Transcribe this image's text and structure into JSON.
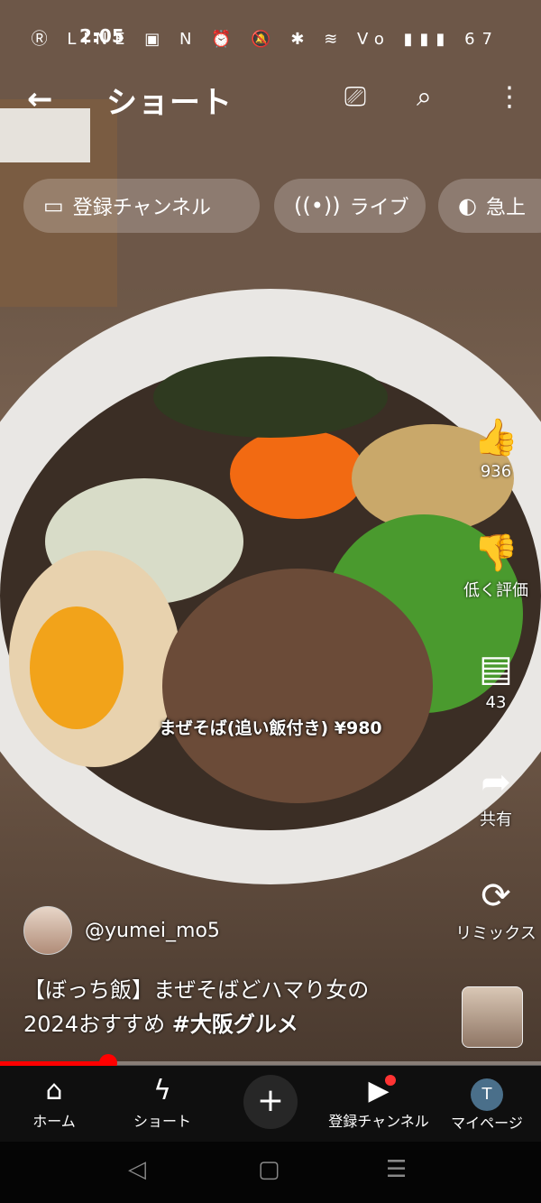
{
  "status_bar": {
    "time": "2:05",
    "icons_text": "Ⓡ LINE ▣      N ⏰ 🔕 ✱ ≋ Vo ▮▮▮ 67",
    "battery": "67"
  },
  "header": {
    "back_icon": "←",
    "title": "ショート",
    "cast_icon": "⎚",
    "search_icon": "⌕",
    "more_icon": "⋮"
  },
  "chips": [
    {
      "icon": "▭",
      "label": "登録チャンネル"
    },
    {
      "icon": "((•))",
      "label": "ライブ"
    },
    {
      "icon": "◐",
      "label": "急上"
    }
  ],
  "actions": {
    "like": {
      "icon": "👍",
      "label": "936"
    },
    "dislike": {
      "icon": "👎",
      "label": "低く評価"
    },
    "comment": {
      "icon": "▤",
      "label": "43"
    },
    "share": {
      "icon": "➦",
      "label": "共有"
    },
    "remix": {
      "icon": "⟳",
      "label": "リミックス"
    }
  },
  "video_overlay_text": "まぜそば(追い飯付き) ¥980",
  "channel": {
    "handle": "@yumei_mo5"
  },
  "caption": {
    "line1": "【ぼっち飯】まぜそばどハマり女の",
    "line2_prefix": "2024おすすめ ",
    "hashtag": "#大阪グルメ"
  },
  "progress": {
    "played_fraction": 0.2
  },
  "bottom_nav": {
    "home": {
      "icon": "⌂",
      "label": "ホーム"
    },
    "shorts": {
      "icon": "ϟ",
      "label": "ショート"
    },
    "create": {
      "icon": "+"
    },
    "subscriptions": {
      "icon": "▶",
      "label": "登録チャンネル"
    },
    "mypage": {
      "avatar_letter": "T",
      "label": "マイページ"
    }
  },
  "system_nav": {
    "back": "◁",
    "home": "▢",
    "recents": "☰"
  },
  "colors": {
    "accent_red": "#ff0000",
    "nav_bg": "#0f0f0f"
  }
}
